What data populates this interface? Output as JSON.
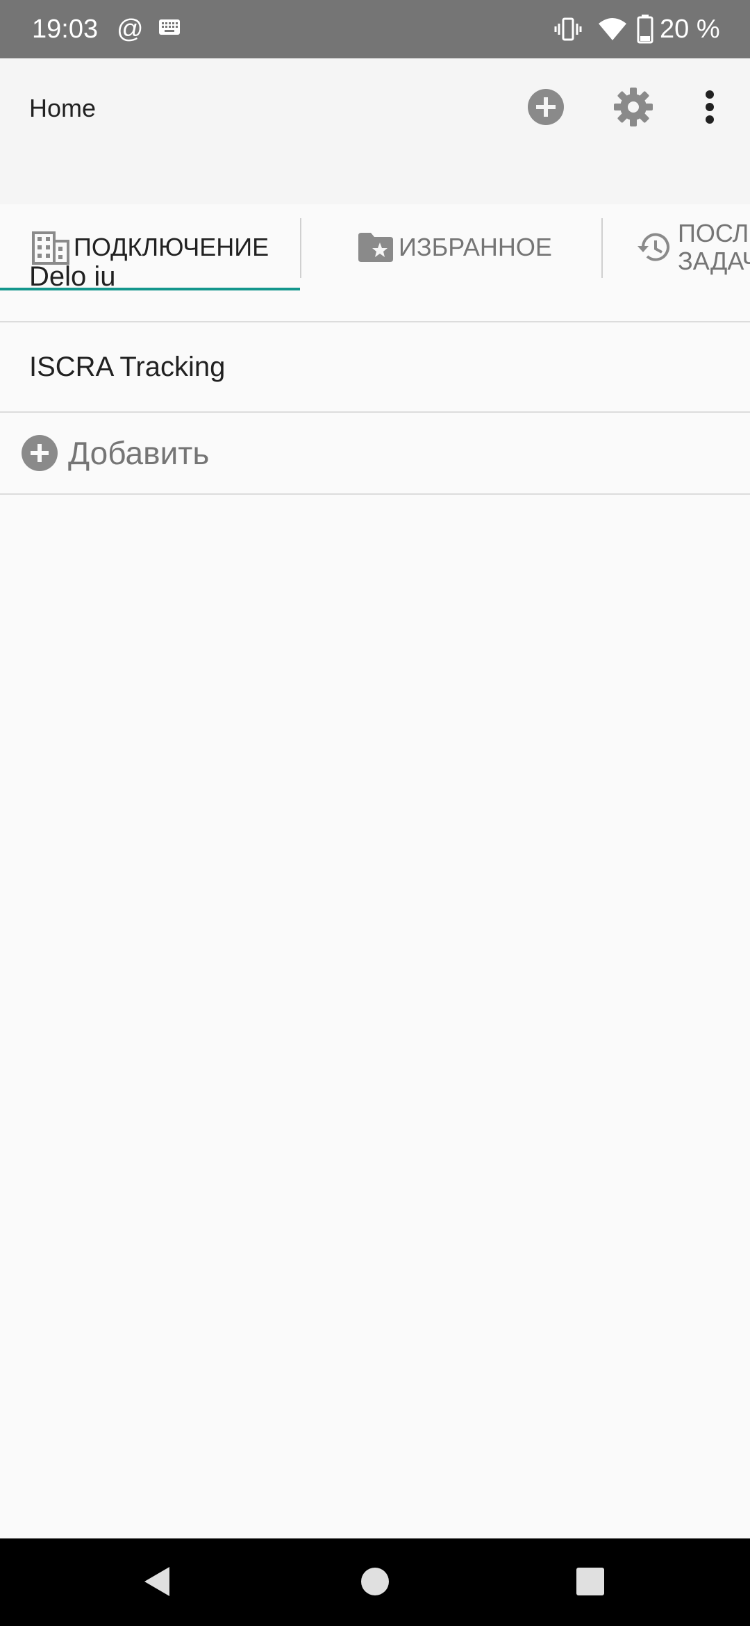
{
  "status_bar": {
    "time": "19:03",
    "at_symbol": "@",
    "battery_text": "20 %",
    "icons": [
      "at-icon",
      "keyboard-icon",
      "vibrate-icon",
      "wifi-icon",
      "battery-icon"
    ]
  },
  "app_bar": {
    "title": "Home",
    "actions": [
      "add-circle-icon",
      "gear-icon",
      "more-vert-icon"
    ]
  },
  "tabs": [
    {
      "label": "ПОДКЛЮЧЕНИЕ",
      "icon": "building-icon",
      "active": true
    },
    {
      "label": "ИЗБРАННОЕ",
      "icon": "folder-star-icon",
      "active": false
    },
    {
      "label": "ПОСЛ ЗАДАЧ",
      "icon": "history-icon",
      "active": false
    }
  ],
  "connections": [
    {
      "label": "Delo iu"
    },
    {
      "label": "ISCRA Tracking"
    }
  ],
  "add_row": {
    "label": "Добавить",
    "icon": "add-circle-icon"
  },
  "nav_bar": {
    "icons": [
      "back-icon",
      "home-icon",
      "recents-icon"
    ]
  },
  "colors": {
    "status_bar": "#757575",
    "app_bar": "#f5f5f5",
    "accent": "#14968c",
    "icon_gray": "#8a8a8a",
    "background": "#fafafa"
  }
}
